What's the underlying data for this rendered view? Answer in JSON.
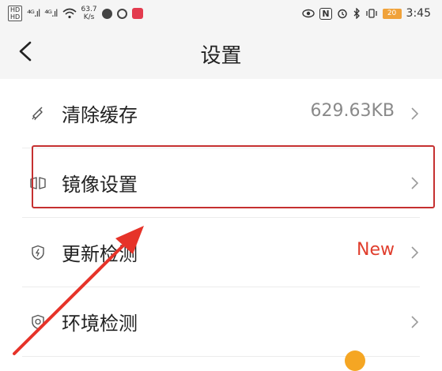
{
  "status_bar": {
    "hd_top": "HD",
    "hd_bottom": "HD",
    "signal_1": "⁴ᴳ.ıl",
    "signal_2": "⁴ᴳ.ıl",
    "net_speed_value": "63.7",
    "net_speed_unit": "K/s",
    "nfc": "N",
    "battery": "20",
    "time": "3:45"
  },
  "header": {
    "title": "设置"
  },
  "settings": {
    "items": [
      {
        "label": "清除缓存",
        "value": "629.63KB",
        "icon": "broom-icon"
      },
      {
        "label": "镜像设置",
        "value": "",
        "icon": "mirror-icon"
      },
      {
        "label": "更新检测",
        "value": "New",
        "icon": "update-shield-icon"
      },
      {
        "label": "环境检测",
        "value": "",
        "icon": "environment-check-icon"
      }
    ]
  },
  "colors": {
    "accent_red": "#e03e2d",
    "highlight_red": "#c53030",
    "header_bg": "#f5f5f5"
  }
}
